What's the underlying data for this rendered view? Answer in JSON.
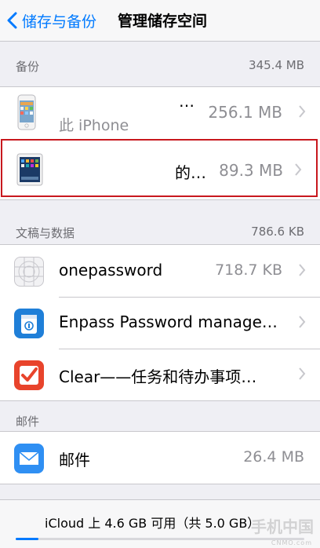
{
  "nav": {
    "back_label": "储存与备份",
    "title": "管理储存空间"
  },
  "backup": {
    "header": "备份",
    "total": "345.4 MB",
    "iphone": {
      "name": "此 iPhone",
      "ellipsis": "…",
      "size": "256.1 MB"
    },
    "ipad": {
      "name": "的…",
      "size": "89.3 MB"
    }
  },
  "documents": {
    "header": "文稿与数据",
    "total": "786.6 KB",
    "items": [
      {
        "label": "onepassword",
        "size": "718.7 KB"
      },
      {
        "label": "Enpass Password manage…",
        "size": ""
      },
      {
        "label": "Clear——任务和待办事项…",
        "size": ""
      }
    ]
  },
  "mail": {
    "header": "邮件",
    "items": [
      {
        "label": "邮件",
        "size": "26.4 MB"
      }
    ]
  },
  "footer": {
    "text": "iCloud 上 4.6 GB 可用（共 5.0 GB）",
    "used_fraction": 0.08
  },
  "watermark": {
    "text": "手机中国",
    "sub": "CNMO.com"
  },
  "colors": {
    "accent": "#007aff",
    "highlight": "#c8181e",
    "clear_icon": "#e8442c",
    "enpass_icon": "#1f7fd8",
    "mail_icon": "#2f8ff3"
  }
}
